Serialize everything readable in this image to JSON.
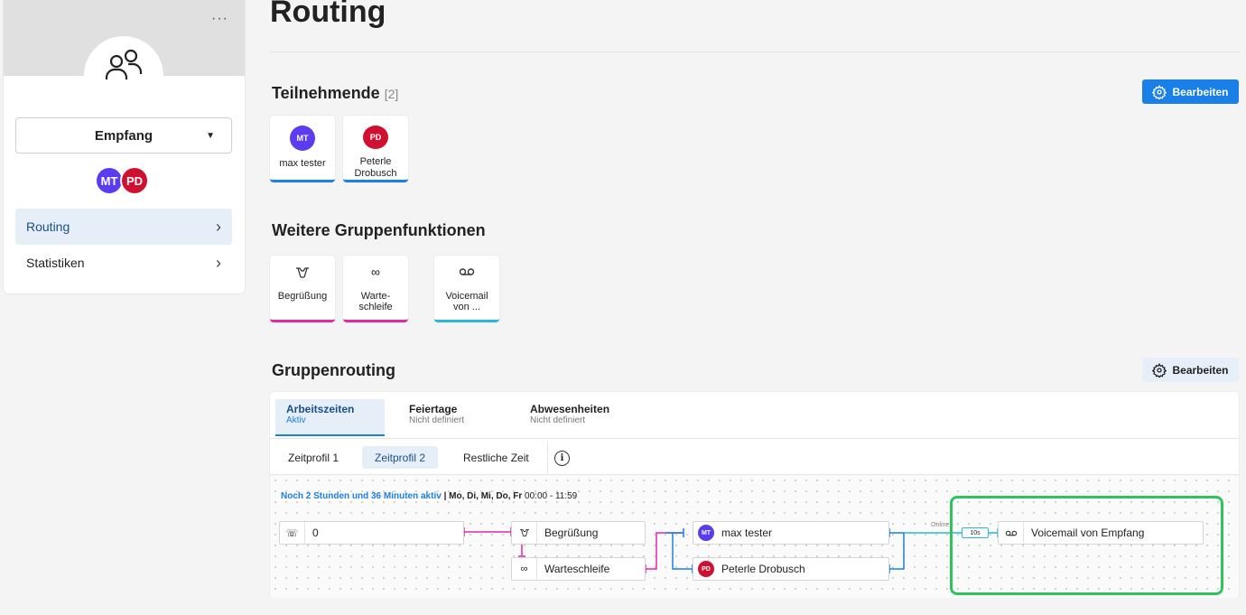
{
  "sidebar": {
    "menu_dots": "···",
    "group_select": "Empfang",
    "members": [
      {
        "initials": "MT",
        "color": "#5b3cf0"
      },
      {
        "initials": "PD",
        "color": "#d01030"
      }
    ],
    "nav": [
      {
        "label": "Routing",
        "active": true
      },
      {
        "label": "Statistiken",
        "active": false
      }
    ]
  },
  "page": {
    "title": "Routing"
  },
  "participants": {
    "heading": "Teilnehmende",
    "count": "[2]",
    "edit_label": "Bearbeiten",
    "cards": [
      {
        "initials": "MT",
        "name": "max tester",
        "color": "#5b3cf0"
      },
      {
        "initials": "PD",
        "name": "Peterle Drobusch",
        "color": "#d01030"
      }
    ]
  },
  "functions": {
    "heading": "Weitere Gruppenfunktionen",
    "cards": [
      {
        "label": "Begrüßung",
        "icon": "greeting-icon",
        "accent": "#e02ba8"
      },
      {
        "label": "Warte-\nschleife",
        "icon": "infinity-icon",
        "accent": "#e02ba8"
      },
      {
        "label": "Voicemail von ...",
        "icon": "voicemail-icon",
        "accent": "#2bb8d6"
      }
    ]
  },
  "routing": {
    "heading": "Gruppenrouting",
    "edit_label": "Bearbeiten",
    "tabs": [
      {
        "title": "Arbeitszeiten",
        "subtitle": "Aktiv",
        "active": true
      },
      {
        "title": "Feiertage",
        "subtitle": "Nicht definiert",
        "active": false
      },
      {
        "title": "Abwesenheiten",
        "subtitle": "Nicht definiert",
        "active": false
      }
    ],
    "profiles": [
      {
        "label": "Zeitprofil 1",
        "active": false
      },
      {
        "label": "Zeitprofil 2",
        "active": true
      },
      {
        "label": "Restliche Zeit",
        "active": false
      }
    ],
    "info_icon": "i",
    "status_active": "Noch 2 Stunden und 36 Minuten aktiv",
    "status_days": "| Mo, Di, Mi, Do, Fr",
    "status_time": "00:00 - 11:59",
    "nodes": {
      "incoming": "0",
      "greeting": "Begrüßung",
      "queue": "Warteschleife",
      "member1": "max tester",
      "member2": "Peterle Drobusch",
      "voicemail": "Voicemail von Empfang"
    },
    "online_label": "Online",
    "timeout_label": "10s",
    "colors": {
      "accent": "#1a7fe6",
      "magenta": "#e02ba8",
      "cyan": "#2bb8d6",
      "highlight": "#2ec45a"
    }
  }
}
